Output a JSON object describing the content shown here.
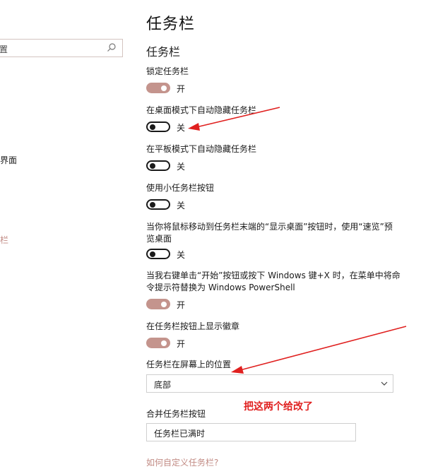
{
  "sidebar": {
    "search_text": "置",
    "items": [
      {
        "label": "界面"
      },
      {
        "label": "栏"
      }
    ]
  },
  "header": {
    "title": "任务栏",
    "section": "任务栏"
  },
  "settings": [
    {
      "label": "锁定任务栏",
      "state": "on",
      "state_label": "开"
    },
    {
      "label": "在桌面模式下自动隐藏任务栏",
      "state": "off",
      "state_label": "关"
    },
    {
      "label": "在平板模式下自动隐藏任务栏",
      "state": "off",
      "state_label": "关"
    },
    {
      "label": "使用小任务栏按钮",
      "state": "off",
      "state_label": "关"
    },
    {
      "label": "当你将鼠标移动到任务栏末端的“显示桌面”按钮时，使用“速览”预览桌面",
      "state": "off",
      "state_label": "关"
    },
    {
      "label": "当我右键单击“开始”按钮或按下 Windows 键+X 时，在菜单中将命令提示符替换为 Windows PowerShell",
      "state": "on",
      "state_label": "开"
    },
    {
      "label": "在任务栏按钮上显示徽章",
      "state": "on",
      "state_label": "开"
    }
  ],
  "position": {
    "label": "任务栏在屏幕上的位置",
    "value": "底部"
  },
  "combine": {
    "label": "合并任务栏按钮",
    "value": "任务栏已满时"
  },
  "annotation": "把这两个给改了",
  "help_link": "如何自定义任务栏?",
  "colors": {
    "accent": "#c4948d",
    "annotation_red": "#e0201f"
  }
}
